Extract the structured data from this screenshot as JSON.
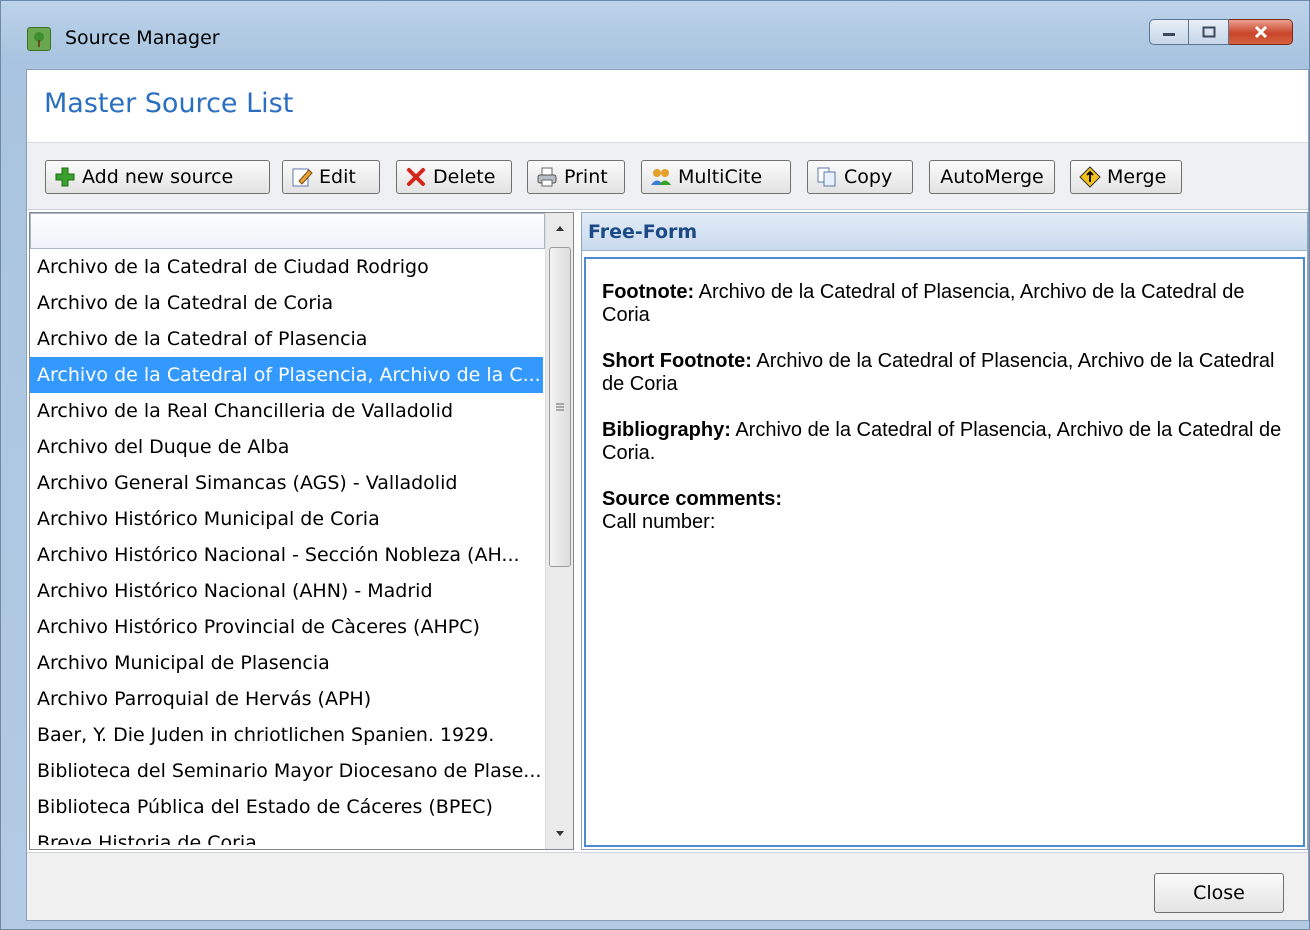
{
  "window": {
    "title": "Source Manager",
    "header": "Master Source List"
  },
  "toolbar": {
    "buttons": [
      {
        "label": "Add new source",
        "icon": "plus-icon"
      },
      {
        "label": "Edit",
        "icon": "edit-icon"
      },
      {
        "label": "Delete",
        "icon": "delete-x-icon"
      },
      {
        "label": "Print",
        "icon": "printer-icon"
      },
      {
        "label": "MultiCite",
        "icon": "people-icon"
      },
      {
        "label": "Copy",
        "icon": "copy-icon"
      },
      {
        "label": "AutoMerge",
        "icon": ""
      },
      {
        "label": "Merge",
        "icon": "merge-sign-icon"
      }
    ]
  },
  "source_list": {
    "filter_value": "",
    "items": [
      "Archivo de la Catedral de Ciudad Rodrigo",
      "Archivo de la Catedral de Coria",
      "Archivo de la Catedral of Plasencia",
      "Archivo de la Catedral of Plasencia, Archivo de la C...",
      "Archivo de la Real Chancilleria de Valladolid",
      "Archivo del Duque de Alba",
      "Archivo General Simancas (AGS) - Valladolid",
      "Archivo Histórico Municipal de Coria",
      "Archivo Histórico Nacional - Sección Nobleza (AH...",
      "Archivo Histórico Nacional (AHN) - Madrid",
      "Archivo Histórico Provincial de Càceres (AHPC)",
      "Archivo Municipal de Plasencia",
      "Archivo Parroquial de Hervás (APH)",
      "Baer, Y. Die Juden in chriotlichen Spanien. 1929.",
      "Biblioteca del Seminario Mayor Diocesano de Plase...",
      "Biblioteca Pública del Estado de Cáceres (BPEC)",
      "Breve Historia de Coria"
    ],
    "selected_index": 3
  },
  "detail": {
    "template_name": "Free-Form",
    "footnote_label": "Footnote:",
    "footnote_text": "Archivo de la Catedral of Plasencia, Archivo de la Catedral de Coria",
    "short_footnote_label": "Short Footnote:",
    "short_footnote_text": "Archivo de la Catedral of Plasencia, Archivo de la Catedral de Coria",
    "bibliography_label": "Bibliography:",
    "bibliography_text": "Archivo de la Catedral of Plasencia, Archivo de la Catedral de Coria.",
    "comments_label": "Source comments:",
    "call_number_label": "Call number:"
  },
  "footer": {
    "close_label": "Close"
  },
  "colors": {
    "header_title": "#2a6fc0",
    "selection": "#3399ff",
    "detail_header_text": "#1c4a86"
  }
}
